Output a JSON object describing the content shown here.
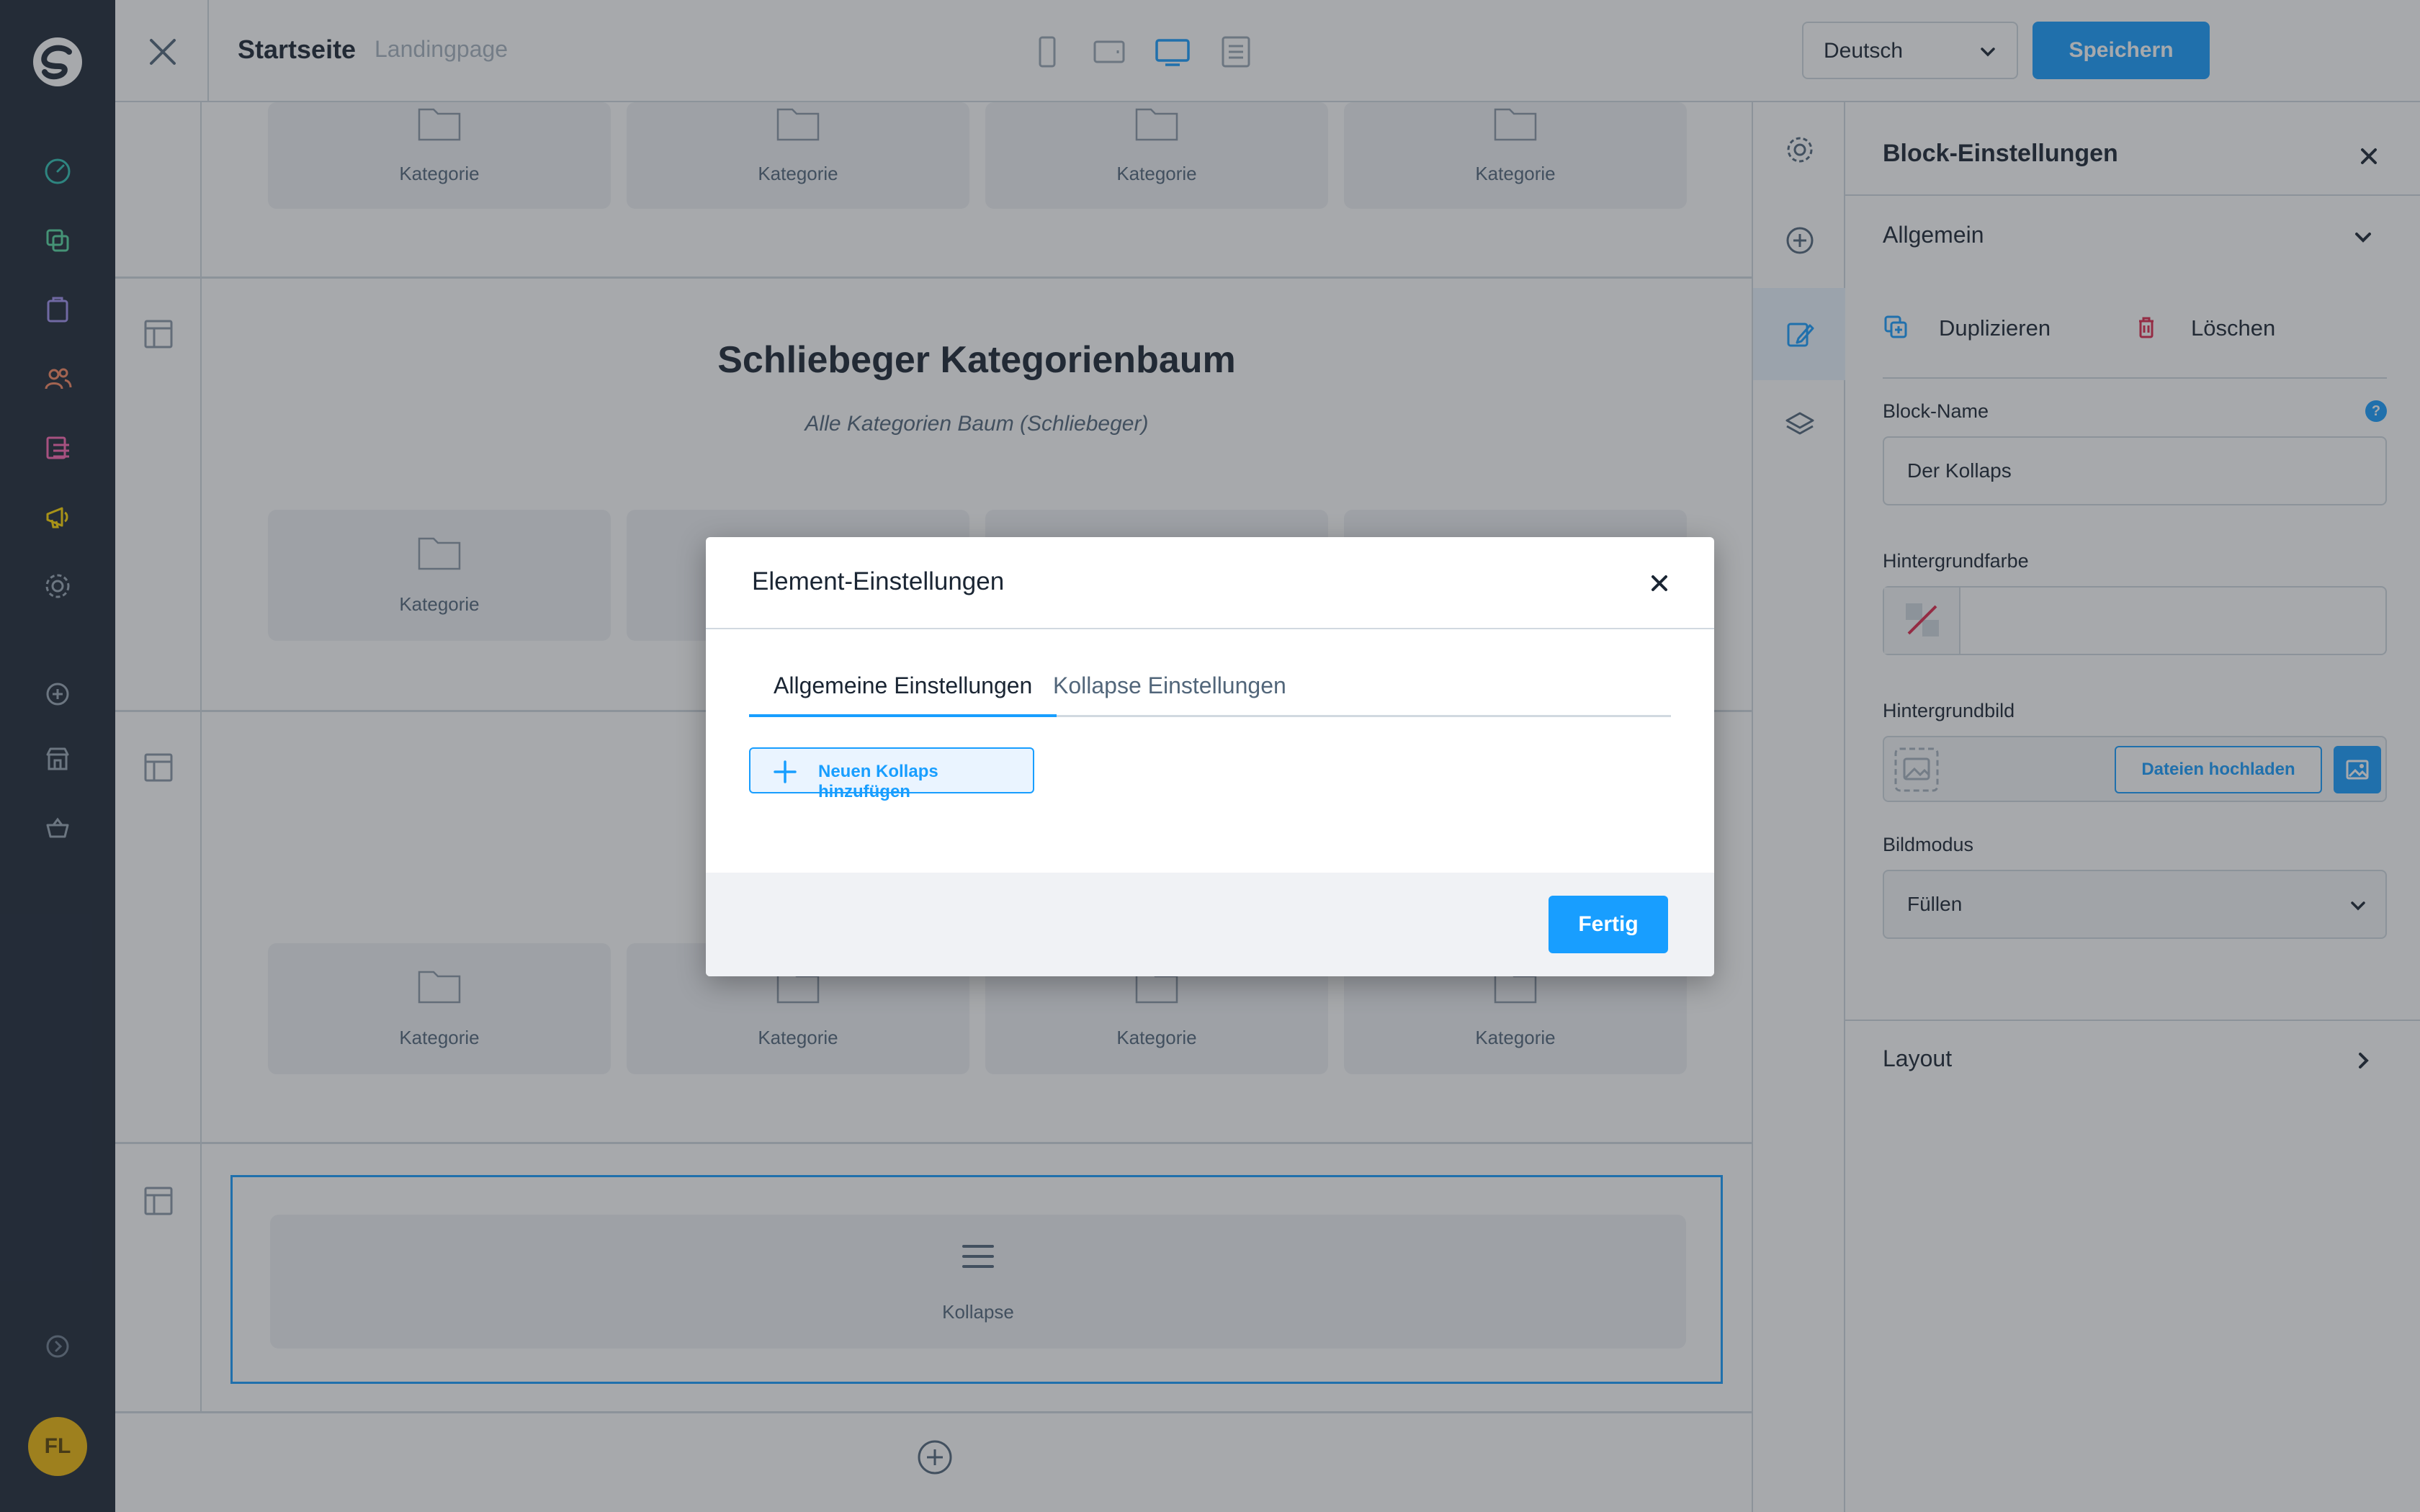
{
  "app": {
    "title": "Startseite",
    "subtitle": "Landingpage",
    "language": "Deutsch",
    "save_label": "Speichern",
    "user_initials": "FL",
    "accent_color": "#189eff"
  },
  "nav_icons": [
    "logo-icon",
    "dashboard-icon",
    "catalogue-icon",
    "orders-icon",
    "customers-icon",
    "content-icon",
    "marketing-icon",
    "settings-icon",
    "add-icon",
    "storefront-icon",
    "basket-icon",
    "expand-icon"
  ],
  "canvas": {
    "tile_label": "Kategorie",
    "block_title": "Schliebeger Kategorienbaum",
    "block_subtitle": "Alle Kategorien Baum (Schliebeger)",
    "collapse_label": "Kollapse"
  },
  "panel": {
    "title": "Block-Einstellungen",
    "section_general": "Allgemein",
    "duplicate_label": "Duplizieren",
    "delete_label": "Löschen",
    "block_name_label": "Block-Name",
    "block_name_value": "Der Kollaps",
    "bg_color_label": "Hintergrundfarbe",
    "bg_image_label": "Hintergrundbild",
    "upload_label": "Dateien hochladen",
    "image_mode_label": "Bildmodus",
    "image_mode_value": "Füllen",
    "section_layout": "Layout"
  },
  "modal": {
    "title": "Element-Einstellungen",
    "tabs": [
      "Allgemeine Einstellungen",
      "Kollapse Einstellungen"
    ],
    "add_collapse_label": "Neuen Kollaps hinzufügen",
    "done_label": "Fertig"
  }
}
